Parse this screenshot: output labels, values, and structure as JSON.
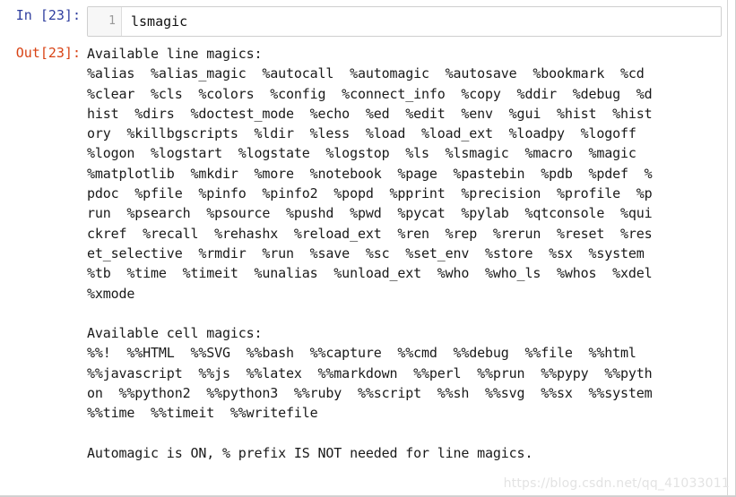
{
  "cell": {
    "input_prompt": "In [23]:",
    "output_prompt": "Out[23]:",
    "line_number": "1",
    "code": "lsmagic"
  },
  "colors": {
    "input_prompt": "#303f9f",
    "output_prompt": "#d84315",
    "cell_border": "#cfcfcf",
    "gutter_background": "#f7f7f7",
    "text": "#1a1a1a",
    "watermark": "#e3e3e3"
  },
  "output": {
    "text": "Available line magics:\n%alias  %alias_magic  %autocall  %automagic  %autosave  %bookmark  %cd\n%clear  %cls  %colors  %config  %connect_info  %copy  %ddir  %debug  %d\nhist  %dirs  %doctest_mode  %echo  %ed  %edit  %env  %gui  %hist  %hist\nory  %killbgscripts  %ldir  %less  %load  %load_ext  %loadpy  %logoff\n%logon  %logstart  %logstate  %logstop  %ls  %lsmagic  %macro  %magic\n%matplotlib  %mkdir  %more  %notebook  %page  %pastebin  %pdb  %pdef  %\npdoc  %pfile  %pinfo  %pinfo2  %popd  %pprint  %precision  %profile  %p\nrun  %psearch  %psource  %pushd  %pwd  %pycat  %pylab  %qtconsole  %qui\nckref  %recall  %rehashx  %reload_ext  %ren  %rep  %rerun  %reset  %res\net_selective  %rmdir  %run  %save  %sc  %set_env  %store  %sx  %system\n%tb  %time  %timeit  %unalias  %unload_ext  %who  %who_ls  %whos  %xdel\n%xmode\n\nAvailable cell magics:\n%%!  %%HTML  %%SVG  %%bash  %%capture  %%cmd  %%debug  %%file  %%html\n%%javascript  %%js  %%latex  %%markdown  %%perl  %%prun  %%pypy  %%pyth\non  %%python2  %%python3  %%ruby  %%script  %%sh  %%svg  %%sx  %%system\n%%time  %%timeit  %%writefile\n\nAutomagic is ON, % prefix IS NOT needed for line magics."
  },
  "watermark": {
    "text": "https://blog.csdn.net/qq_41033011"
  }
}
